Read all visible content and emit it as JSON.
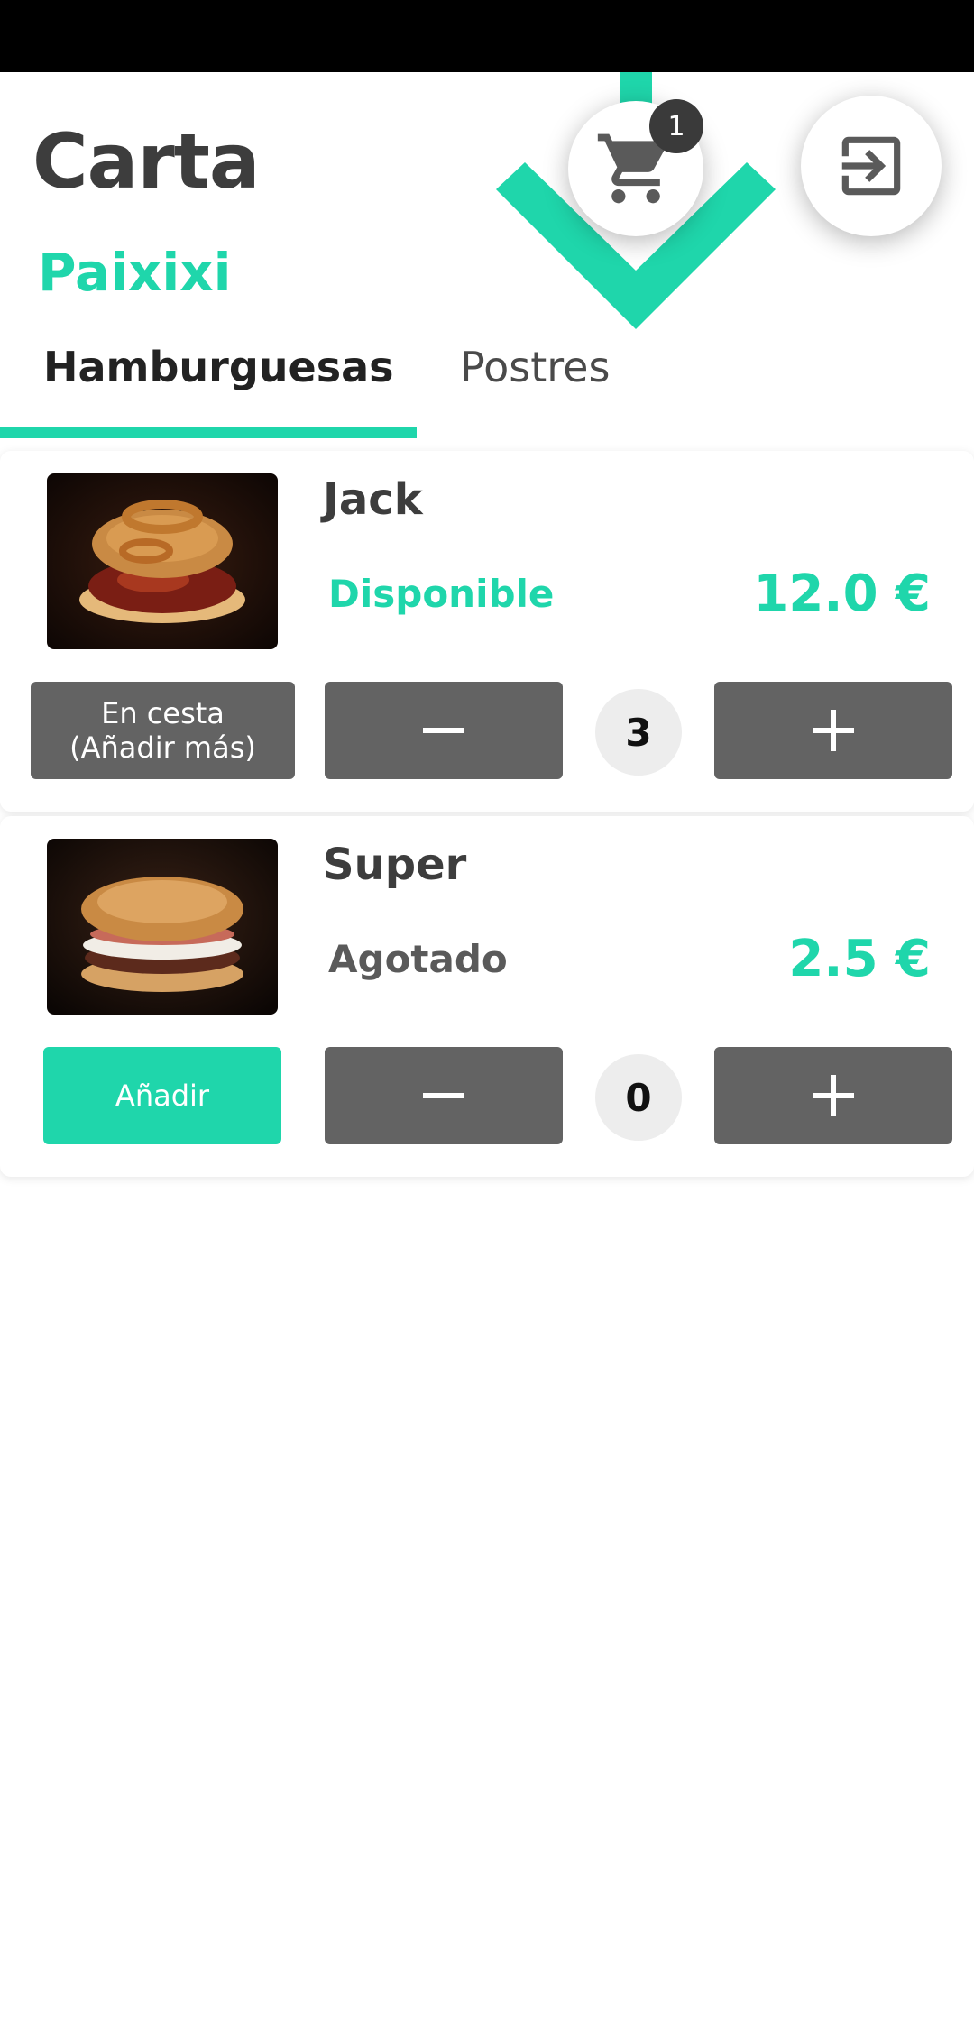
{
  "header": {
    "title": "Carta",
    "restaurant": "Paixixi",
    "cart_count": "1",
    "cart_icon": "cart-icon",
    "logout_icon": "exit-icon"
  },
  "tabs": [
    {
      "label": "Hamburguesas",
      "active": true
    },
    {
      "label": "Postres",
      "active": false
    }
  ],
  "items": [
    {
      "name": "Jack",
      "status": "Disponible",
      "price": "12.0 €",
      "action_line1": "En cesta",
      "action_line2": "(Añadir más)",
      "quantity": "3"
    },
    {
      "name": "Super",
      "status": "Agotado",
      "price": "2.5 €",
      "action_label": "Añadir",
      "quantity": "0"
    }
  ],
  "colors": {
    "accent": "#1fd6ab",
    "button_dark": "#636363",
    "text_dark": "#3d3d3d"
  }
}
